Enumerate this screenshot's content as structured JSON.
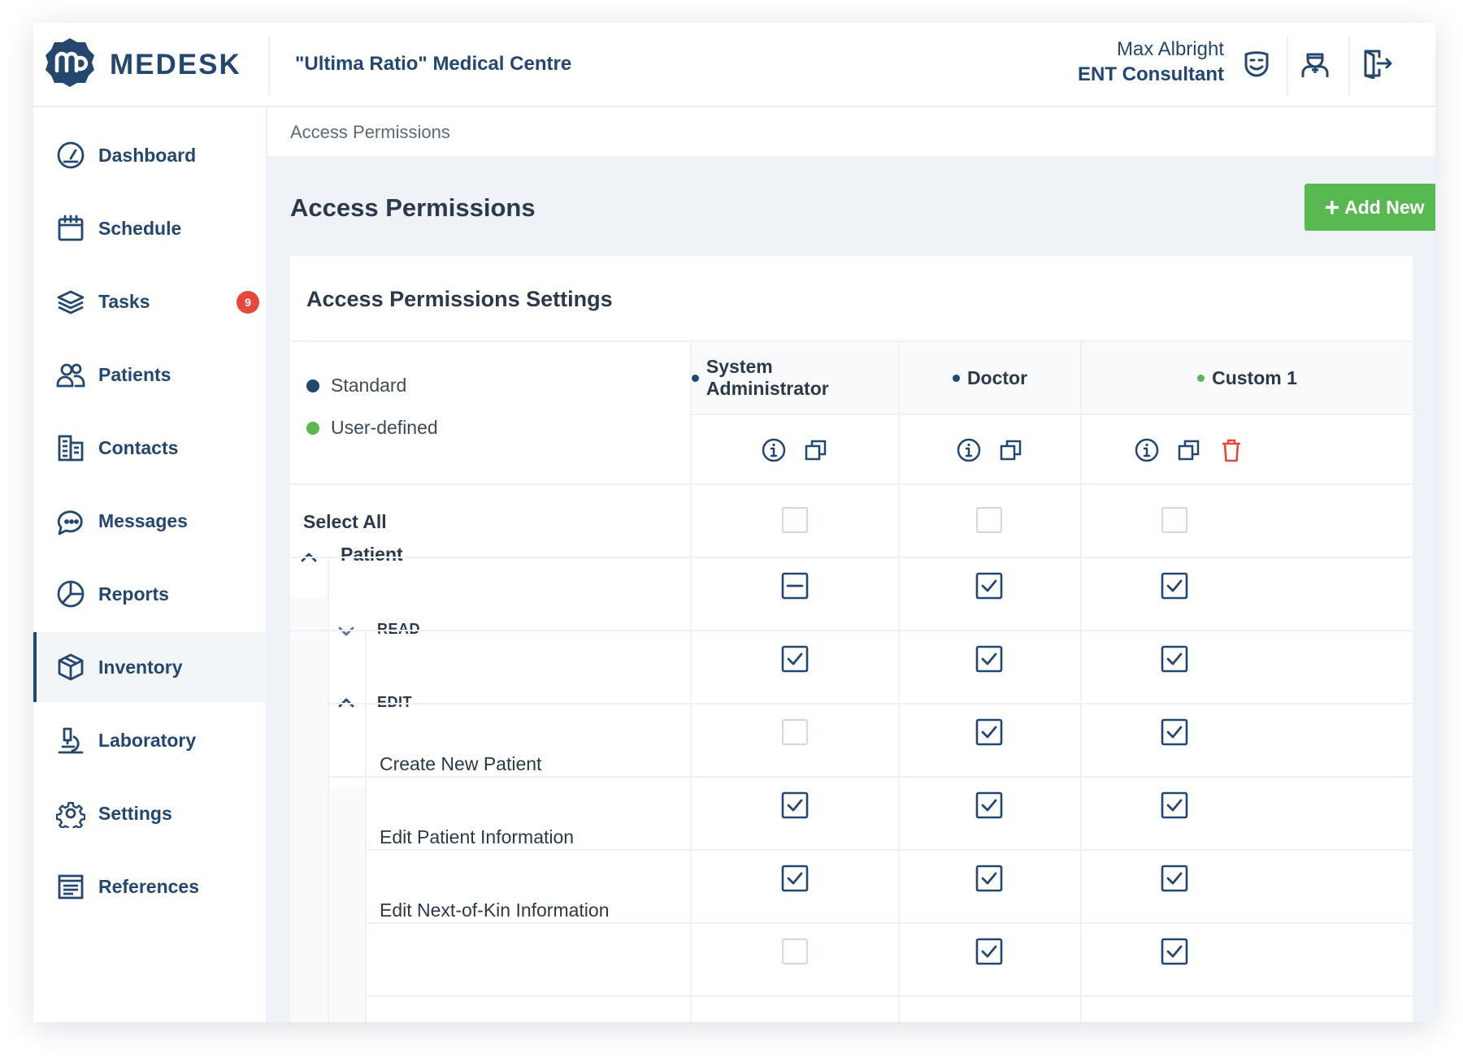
{
  "brand": {
    "name": "MEDESK",
    "clinic": "\"Ultima Ratio\" Medical Centre"
  },
  "user": {
    "name": "Max Albright",
    "role": "ENT Consultant"
  },
  "header_icons": [
    "smile-face-icon",
    "doctor-avatar-icon",
    "logout-icon"
  ],
  "sidebar": {
    "items": [
      {
        "label": "Dashboard",
        "icon": "gauge-icon"
      },
      {
        "label": "Schedule",
        "icon": "calendar-icon"
      },
      {
        "label": "Tasks",
        "icon": "layers-icon",
        "badge": "9"
      },
      {
        "label": "Patients",
        "icon": "users-icon"
      },
      {
        "label": "Contacts",
        "icon": "building-icon"
      },
      {
        "label": "Messages",
        "icon": "chat-icon"
      },
      {
        "label": "Reports",
        "icon": "pie-chart-icon"
      },
      {
        "label": "Inventory",
        "icon": "box-icon",
        "active": true
      },
      {
        "label": "Laboratory",
        "icon": "microscope-icon"
      },
      {
        "label": "Settings",
        "icon": "gear-icon"
      },
      {
        "label": "References",
        "icon": "book-icon"
      }
    ]
  },
  "breadcrumb": "Access Permissions",
  "page_title": "Access Permissions",
  "add_button": "Add New",
  "card_title": "Access Permissions Settings",
  "legend": [
    {
      "label": "Standard",
      "color": "#24476f"
    },
    {
      "label": "User-defined",
      "color": "#57b94f"
    }
  ],
  "columns": [
    {
      "name": "System Administrator",
      "type": "standard",
      "dot_color": "#24476f",
      "deletable": false
    },
    {
      "name": "Doctor",
      "type": "standard",
      "dot_color": "#24476f",
      "deletable": false
    },
    {
      "name": "Custom 1",
      "type": "user-defined",
      "dot_color": "#57b94f",
      "deletable": true
    }
  ],
  "rows": [
    {
      "label": "Select All",
      "states": [
        "unchecked",
        "unchecked",
        "unchecked"
      ]
    },
    {
      "label": "Patient",
      "expanded": true,
      "states": [
        "indeterminate",
        "checked",
        "checked"
      ]
    },
    {
      "label": "READ",
      "expanded": false,
      "states": [
        "checked",
        "checked",
        "checked"
      ]
    },
    {
      "label": "EDIT",
      "expanded": true,
      "states": [
        "unchecked",
        "checked",
        "checked"
      ]
    },
    {
      "label": "Create New Patient",
      "states": [
        "checked",
        "checked",
        "checked"
      ]
    },
    {
      "label": "Edit Patient Information",
      "states": [
        "checked",
        "checked",
        "checked"
      ]
    },
    {
      "label": "Edit Next-of-Kin Information",
      "states": [
        "unchecked",
        "checked",
        "checked"
      ]
    }
  ],
  "colors": {
    "brand": "#24476f",
    "accent_green": "#57b94f",
    "danger": "#e8473b",
    "background": "#eff3f7"
  }
}
